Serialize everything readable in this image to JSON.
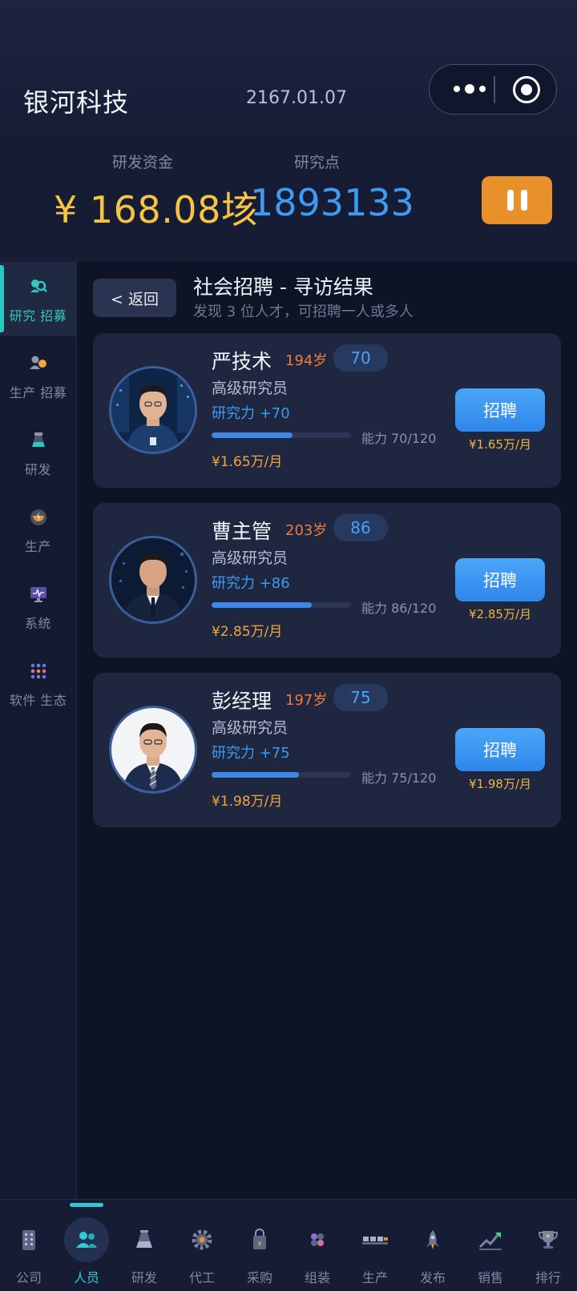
{
  "header": {
    "company_name": "银河科技",
    "date": "2167.01.07"
  },
  "stats": {
    "funds_label": "研发资金",
    "funds_value": "¥ 168.08垓",
    "points_label": "研究点",
    "points_value": "1893133"
  },
  "sidebar": {
    "items": [
      {
        "label": "研究 招募",
        "icon": "research-recruit-icon",
        "active": true
      },
      {
        "label": "生产 招募",
        "icon": "production-recruit-icon",
        "active": false
      },
      {
        "label": "研发",
        "icon": "flask-icon",
        "active": false
      },
      {
        "label": "生产",
        "icon": "power-icon",
        "active": false
      },
      {
        "label": "系统",
        "icon": "monitor-icon",
        "active": false
      },
      {
        "label": "软件 生态",
        "icon": "grid-dots-icon",
        "active": false
      }
    ]
  },
  "main": {
    "back_label": "< 返回",
    "title": "社会招聘 - 寻访结果",
    "subtitle": "发现 3 位人才，可招聘一人或多人"
  },
  "candidates": [
    {
      "name": "严技术",
      "age": "194岁",
      "ability": "70",
      "role": "高级研究员",
      "research": "研究力 +70",
      "capacity_text": "能力 70/120",
      "capacity_fraction": 0.583,
      "salary": "¥1.65万/月",
      "hire_label": "招聘",
      "hire_salary": "¥1.65万/月"
    },
    {
      "name": "曹主管",
      "age": "203岁",
      "ability": "86",
      "role": "高级研究员",
      "research": "研究力 +86",
      "capacity_text": "能力 86/120",
      "capacity_fraction": 0.717,
      "salary": "¥2.85万/月",
      "hire_label": "招聘",
      "hire_salary": "¥2.85万/月"
    },
    {
      "name": "彭经理",
      "age": "197岁",
      "ability": "75",
      "role": "高级研究员",
      "research": "研究力 +75",
      "capacity_text": "能力 75/120",
      "capacity_fraction": 0.625,
      "salary": "¥1.98万/月",
      "hire_label": "招聘",
      "hire_salary": "¥1.98万/月"
    }
  ],
  "bottom_nav": {
    "items": [
      {
        "label": "公司",
        "icon": "building-icon",
        "active": false
      },
      {
        "label": "人员",
        "icon": "people-icon",
        "active": true
      },
      {
        "label": "研发",
        "icon": "flask-icon",
        "active": false
      },
      {
        "label": "代工",
        "icon": "gear-icon",
        "active": false
      },
      {
        "label": "采购",
        "icon": "shopping-bag-icon",
        "active": false
      },
      {
        "label": "组装",
        "icon": "assembly-icon",
        "active": false
      },
      {
        "label": "生产",
        "icon": "conveyor-icon",
        "active": false
      },
      {
        "label": "发布",
        "icon": "rocket-icon",
        "active": false
      },
      {
        "label": "销售",
        "icon": "trend-up-icon",
        "active": false
      },
      {
        "label": "排行",
        "icon": "trophy-icon",
        "active": false
      }
    ]
  },
  "colors": {
    "accent_teal": "#2ec8c0",
    "accent_blue": "#3d9bf3",
    "gold": "#f6c443",
    "orange": "#e8902a"
  }
}
